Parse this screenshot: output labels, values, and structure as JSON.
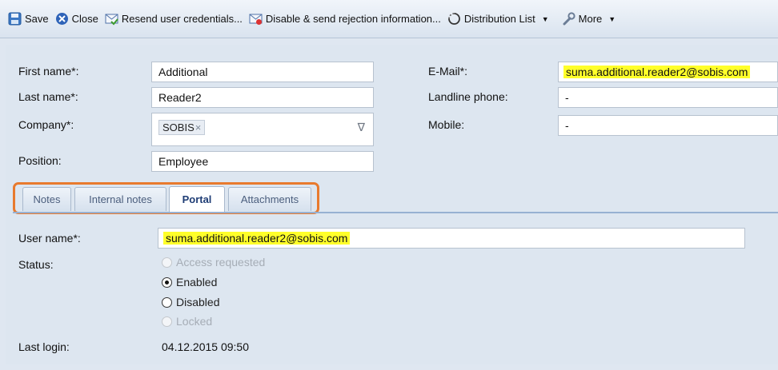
{
  "toolbar": {
    "save": "Save",
    "close": "Close",
    "resend": "Resend user credentials...",
    "disable": "Disable & send rejection information...",
    "distribution": "Distribution List",
    "more": "More"
  },
  "fields": {
    "first_name_label": "First name*:",
    "first_name": "Additional",
    "last_name_label": "Last name*:",
    "last_name": "Reader2",
    "company_label": "Company*:",
    "company_tag": "SOBIS",
    "company_tag_remove": "×",
    "company_dropdown": "∇",
    "position_label": "Position:",
    "position": "Employee",
    "email_label": "E-Mail*:",
    "email": "suma.additional.reader2@sobis.com",
    "landline_label": "Landline phone:",
    "landline": "-",
    "mobile_label": "Mobile:",
    "mobile": "-"
  },
  "tabs": [
    "Notes",
    "Internal notes",
    "Portal",
    "Attachments"
  ],
  "active_tab": "Portal",
  "portal": {
    "username_label": "User name*:",
    "username": "suma.additional.reader2@sobis.com",
    "status_label": "Status:",
    "statuses": [
      {
        "label": "Access requested",
        "selected": false,
        "disabled": true
      },
      {
        "label": "Enabled",
        "selected": true,
        "disabled": false
      },
      {
        "label": "Disabled",
        "selected": false,
        "disabled": false
      },
      {
        "label": "Locked",
        "selected": false,
        "disabled": true
      }
    ],
    "last_login_label": "Last login:",
    "last_login": "04.12.2015 09:50"
  },
  "colors": {
    "highlight": "#ffff2a",
    "tab_outline": "#e87a2e"
  }
}
